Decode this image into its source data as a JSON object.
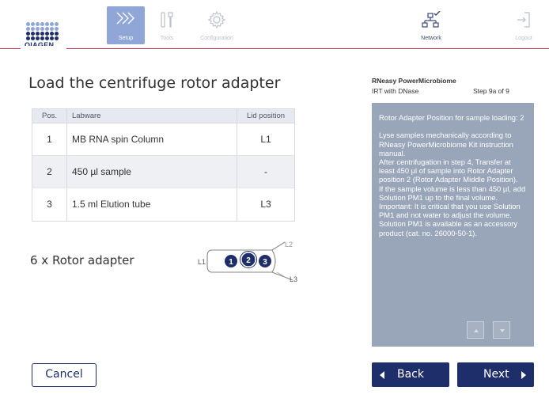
{
  "brand": {
    "logo_text": "QIAGEN",
    "primary_color": "#1d2e6b",
    "accent_color": "#c8334a"
  },
  "nav": {
    "setup": "Setup",
    "tools": "Tools",
    "configuration": "Configuration",
    "network": "Network",
    "logout": "Logout"
  },
  "main": {
    "title": "Load the centrifuge rotor adapter",
    "table": {
      "headers": [
        "Pos.",
        "Labware",
        "Lid position"
      ],
      "rows": [
        [
          "1",
          "MB RNA spin Column",
          "L1"
        ],
        [
          "2",
          "450 µl sample",
          "-"
        ],
        [
          "3",
          "1.5 ml Elution tube",
          "L3"
        ]
      ]
    },
    "rotor_label": "6 x Rotor adapter",
    "diagram": {
      "l1": "L1",
      "l2": "L2",
      "l3": "L3",
      "p1": "1",
      "p2": "2",
      "p3": "3"
    }
  },
  "panel": {
    "protocol": "RNeasy PowerMicrobiome",
    "subtitle": "IRT with DNase",
    "step": "Step 9a of 9",
    "instructions": "Rotor Adapter Position for sample loading: 2\n\nLyse samples mechanically according to RNeasy PowerMicrobiome Kit instruction manual.\nAfter centrifugation in step 4, Transfer at least 450 µl of sample into Rotor Adapter position 2 (Rotor Adapter Middle Position).\nIf the sample volume is less than 450 µl, add Solution PM1 up to the final volume. Important: It is critical that you use Solution PM1 and not water to adjust the volume. Solution PM1 is available as an accessory product (cat. no. 26000-50-1)."
  },
  "buttons": {
    "cancel": "Cancel",
    "back": "Back",
    "next": "Next"
  }
}
